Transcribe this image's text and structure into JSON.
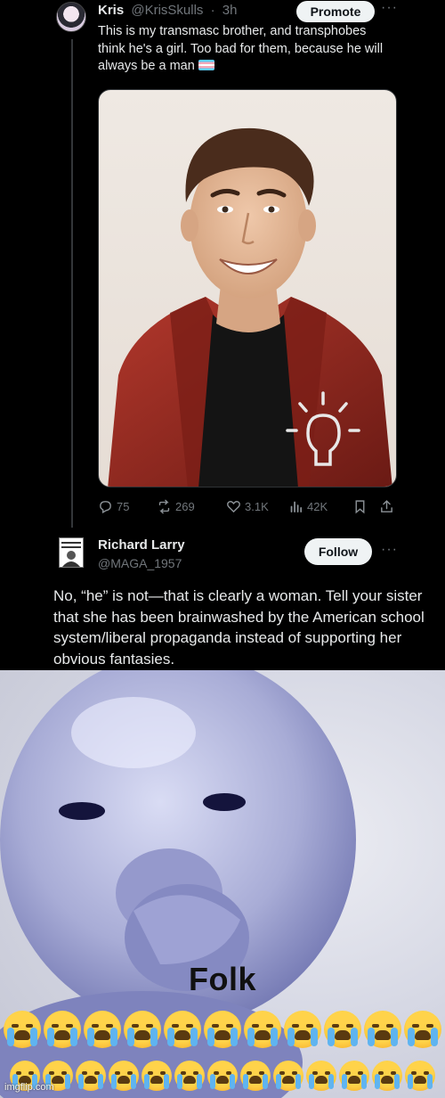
{
  "tweet1": {
    "name": "Kris",
    "handle": "@KrisSkulls",
    "separator": "·",
    "time": "3h",
    "promote_label": "Promote",
    "more_label": "···",
    "text": "This is my transmasc brother, and transphobes think he's a girl. Too bad for them, because he will always be a man",
    "stats": {
      "replies": "75",
      "reposts": "269",
      "likes": "3.1K",
      "views": "42K"
    }
  },
  "tweet2": {
    "name": "Richard Larry",
    "handle": "@MAGA_1957",
    "follow_label": "Follow",
    "more_label": "···",
    "text": "No, “he” is not—that is clearly a woman. Tell your sister that she has been brainwashed by the American school system/liberal propaganda instead of supporting her obvious fantasies."
  },
  "meme": {
    "caption": "Folk",
    "emoji_icon": "loudly-crying-face-icon",
    "row1_count": 11,
    "row2_count": 13,
    "watermark": "imgflip.com"
  },
  "colors": {
    "background": "#000000",
    "text": "#e7e9ea",
    "muted": "#71767b",
    "button": "#eff3f4",
    "jacket": "#8e2a22"
  }
}
